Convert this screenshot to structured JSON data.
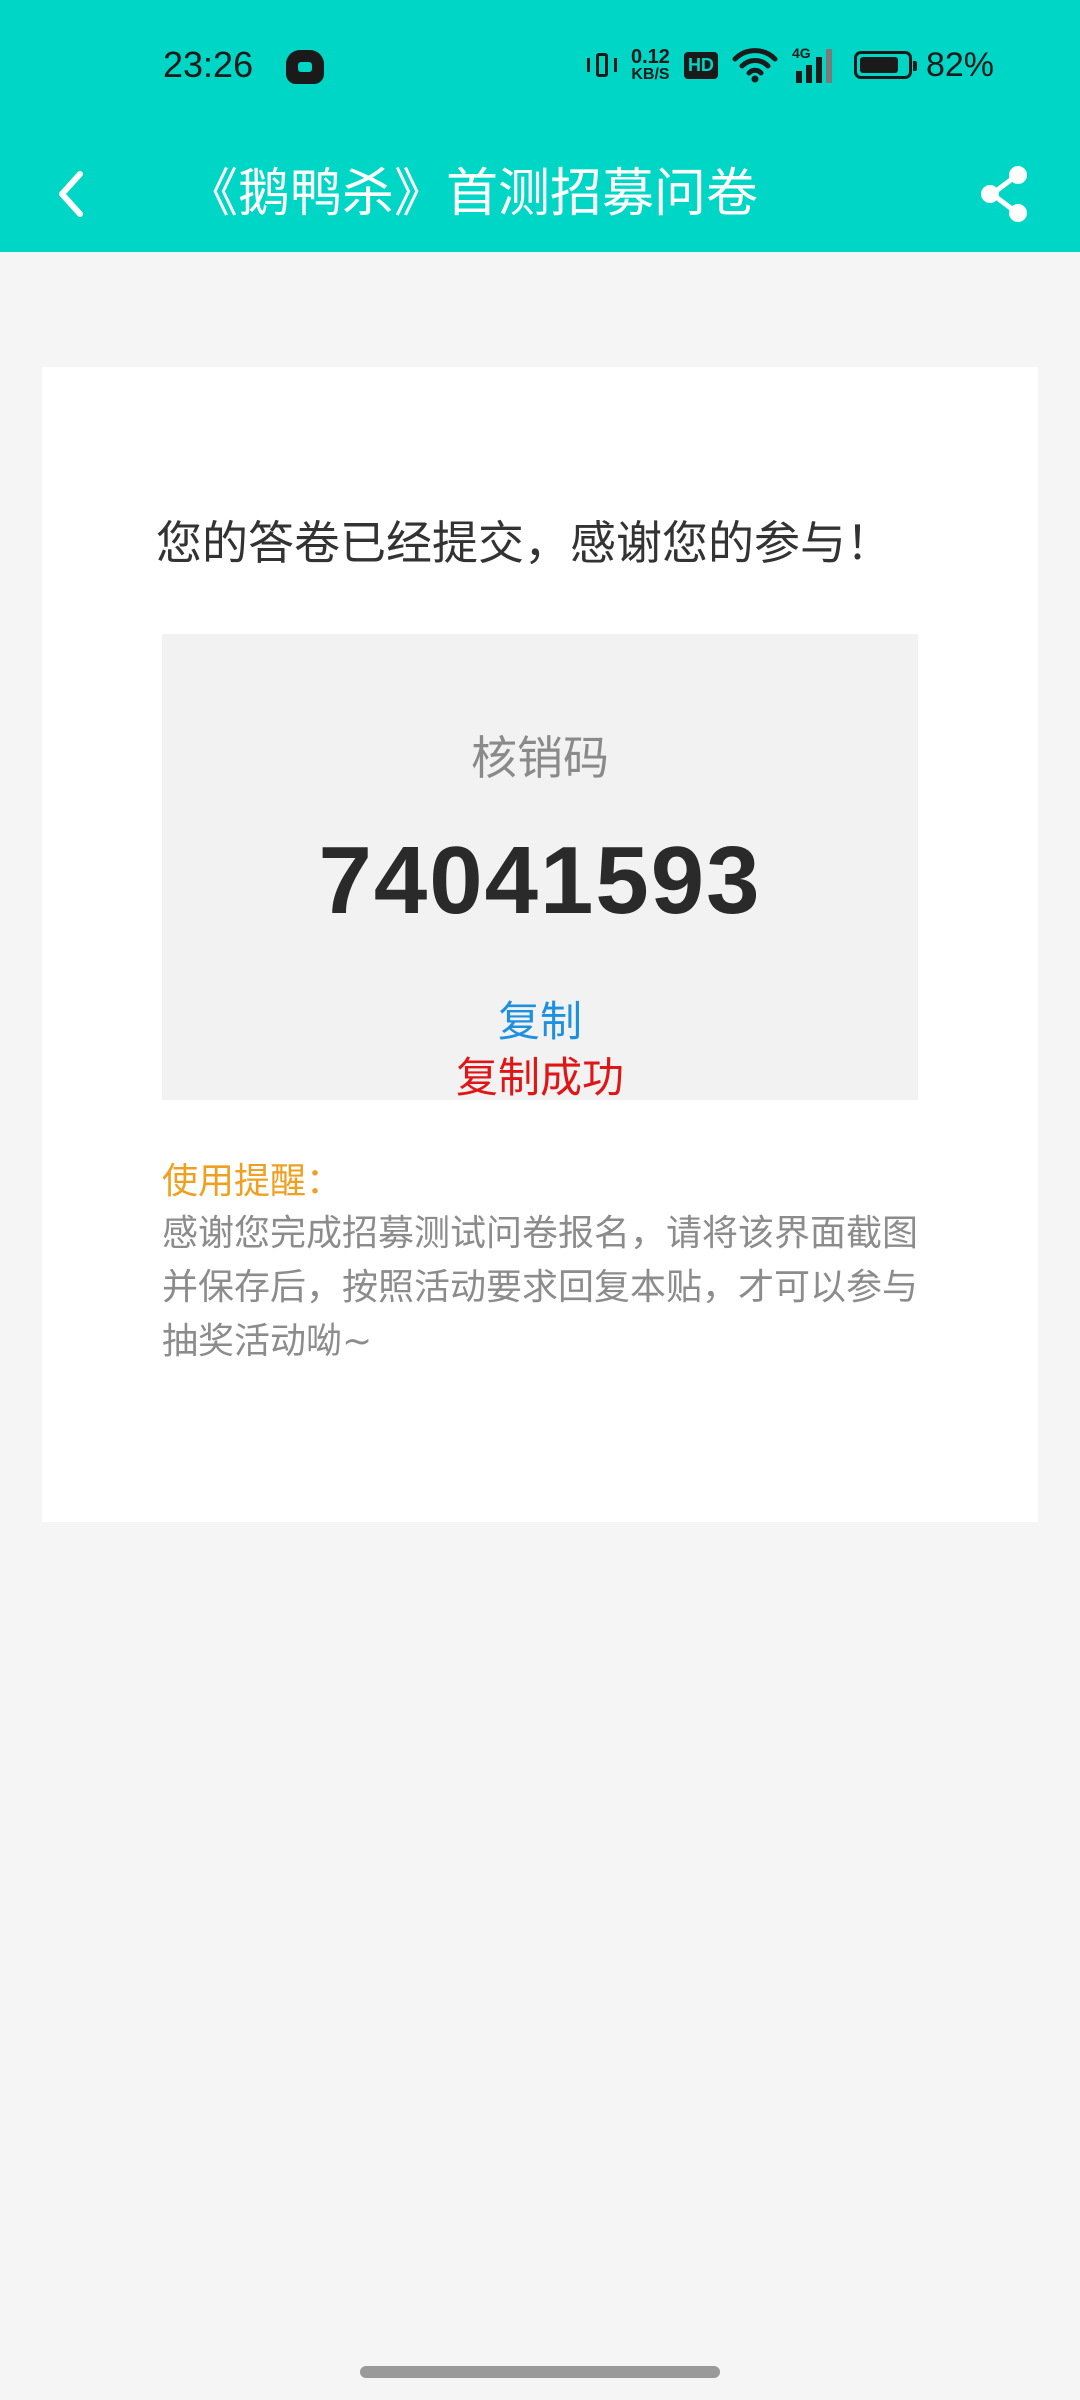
{
  "status_bar": {
    "time": "23:26",
    "net_speed_value": "0.12",
    "net_speed_unit": "KB/S",
    "hd_label": "HD",
    "signal_label": "4G",
    "battery_percent": "82%",
    "battery_level": 0.82
  },
  "app_bar": {
    "title": "《鹅鸭杀》首测招募问卷",
    "back_icon": "chevron-left-icon",
    "share_icon": "share-icon"
  },
  "card": {
    "thanks_text": "您的答卷已经提交，感谢您的参与！",
    "code_label": "核销码",
    "code_value": "74041593",
    "copy_label": "复制",
    "copy_success": "复制成功",
    "reminder_title": "使用提醒：",
    "reminder_text": "感谢您完成招募测试问卷报名，请将该界面截图并保存后，按照活动要求回复本贴，才可以参与抽奖活动呦~"
  },
  "colors": {
    "header": "#00d6c5",
    "copy_link": "#1e90e0",
    "success": "#e01515",
    "reminder_title": "#f0a020"
  }
}
